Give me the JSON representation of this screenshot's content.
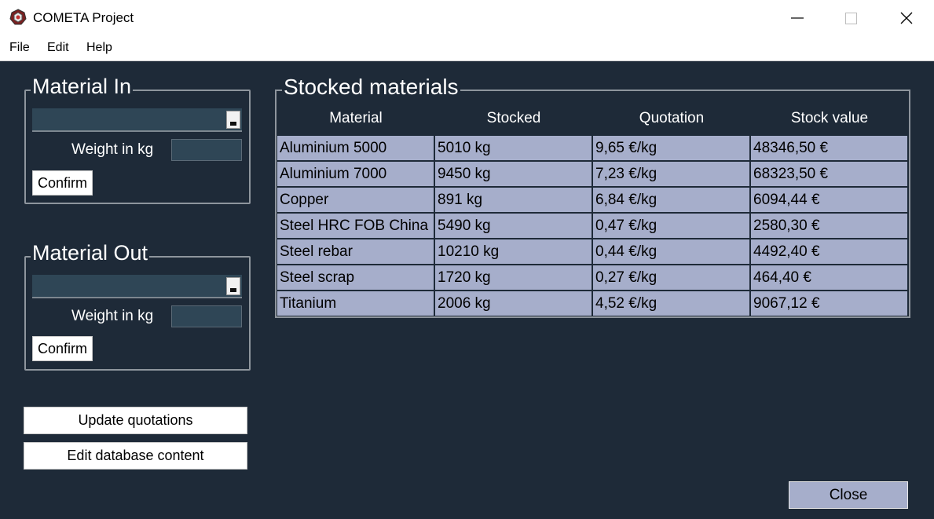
{
  "window": {
    "title": "COMETA Project"
  },
  "menu": [
    "File",
    "Edit",
    "Help"
  ],
  "material_in": {
    "title": "Material In",
    "weight_label": "Weight in kg",
    "confirm_label": "Confirm"
  },
  "material_out": {
    "title": "Material Out",
    "weight_label": "Weight in kg",
    "confirm_label": "Confirm"
  },
  "actions": {
    "update_quotations": "Update quotations",
    "edit_database": "Edit database content"
  },
  "stocked": {
    "title": "Stocked materials",
    "headers": [
      "Material",
      "Stocked",
      "Quotation",
      "Stock value"
    ],
    "rows": [
      [
        "Aluminium 5000",
        "5010 kg",
        "9,65 €/kg",
        "48346,50 €"
      ],
      [
        "Aluminium 7000",
        "9450 kg",
        "7,23 €/kg",
        "68323,50 €"
      ],
      [
        "Copper",
        "891 kg",
        "6,84 €/kg",
        "6094,44 €"
      ],
      [
        "Steel HRC FOB China",
        "5490 kg",
        "0,47 €/kg",
        "2580,30 €"
      ],
      [
        "Steel rebar",
        "10210 kg",
        "0,44 €/kg",
        "4492,40 €"
      ],
      [
        "Steel scrap",
        "1720 kg",
        "0,27 €/kg",
        "464,40 €"
      ],
      [
        "Titanium",
        "2006 kg",
        "4,52 €/kg",
        "9067,12 €"
      ]
    ]
  },
  "close_label": "Close",
  "colors": {
    "background": "#1e2a38",
    "cell": "#a6aecb",
    "input": "#2f4656"
  }
}
